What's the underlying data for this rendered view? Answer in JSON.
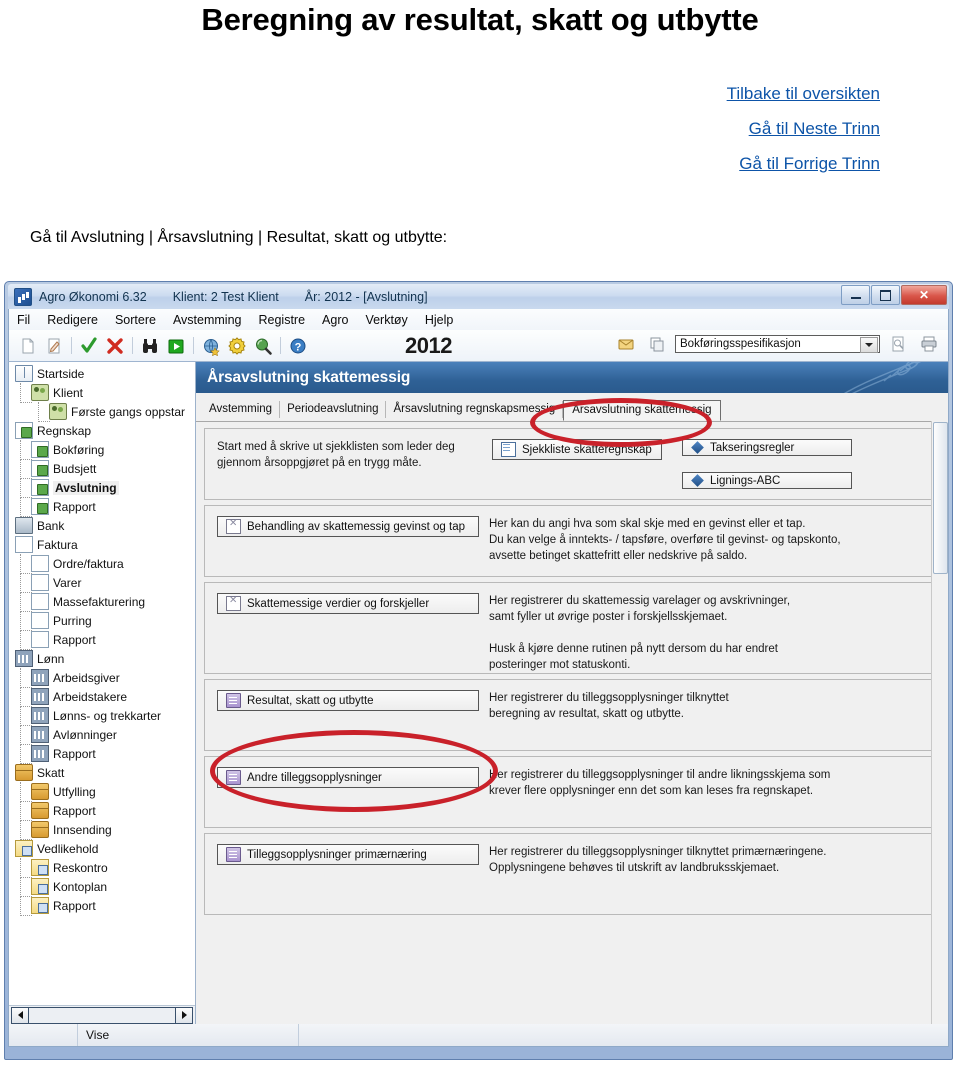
{
  "document": {
    "title": "Beregning av resultat, skatt og utbytte",
    "nav_links": [
      "Tilbake til oversikten",
      "Gå til Neste Trinn",
      "Gå til Forrige Trinn"
    ],
    "breadcrumb": "Gå til Avslutning | Årsavslutning | Resultat, skatt og utbytte:"
  },
  "app": {
    "titlebar": {
      "product": "Agro Økonomi 6.32",
      "client": "Klient:  2 Test Klient",
      "year": "År: 2012 - [Avslutning]",
      "minimize_label": "Minimer",
      "maximize_label": "Maksimer",
      "close_label": "✕"
    },
    "menu": [
      "Fil",
      "Redigere",
      "Sortere",
      "Avstemming",
      "Registre",
      "Agro",
      "Verktøy",
      "Hjelp"
    ],
    "toolbar": {
      "year_display": "2012",
      "combo_value": "Bokføringsspesifikasjon",
      "icons": [
        "new-document-icon",
        "edit-document-icon",
        "confirm-check-icon",
        "delete-cross-icon",
        "binoculars-search-icon",
        "run-play-icon",
        "globe-star-icon",
        "settings-gear-icon",
        "magnifier-icon",
        "help-question-icon"
      ],
      "right_icons": [
        "mail-icon",
        "copy-icon",
        "preview-icon",
        "print-icon"
      ]
    },
    "tree": [
      {
        "label": "Startside",
        "level": 1,
        "icon": "book-icon",
        "selected": false
      },
      {
        "label": "Klient",
        "level": 2,
        "icon": "people-icon",
        "selected": false
      },
      {
        "label": "Første gangs oppstar",
        "level": 3,
        "icon": "people-icon",
        "selected": false
      },
      {
        "label": "Regnskap",
        "level": 1,
        "icon": "check-doc-icon",
        "selected": false
      },
      {
        "label": "Bokføring",
        "level": 2,
        "icon": "check-doc-icon",
        "selected": false
      },
      {
        "label": "Budsjett",
        "level": 2,
        "icon": "check-doc-icon",
        "selected": false
      },
      {
        "label": "Avslutning",
        "level": 2,
        "icon": "check-doc-icon",
        "selected": true
      },
      {
        "label": "Rapport",
        "level": 2,
        "icon": "check-doc-icon",
        "selected": false
      },
      {
        "label": "Bank",
        "level": 1,
        "icon": "bank-icon",
        "selected": false
      },
      {
        "label": "Faktura",
        "level": 1,
        "icon": "doc-icon",
        "selected": false
      },
      {
        "label": "Ordre/faktura",
        "level": 2,
        "icon": "doc-icon",
        "selected": false
      },
      {
        "label": "Varer",
        "level": 2,
        "icon": "doc-icon",
        "selected": false
      },
      {
        "label": "Massefakturering",
        "level": 2,
        "icon": "doc-icon",
        "selected": false
      },
      {
        "label": "Purring",
        "level": 2,
        "icon": "doc-icon",
        "selected": false
      },
      {
        "label": "Rapport",
        "level": 2,
        "icon": "doc-icon",
        "selected": false
      },
      {
        "label": "Lønn",
        "level": 1,
        "icon": "grid-icon",
        "selected": false
      },
      {
        "label": "Arbeidsgiver",
        "level": 2,
        "icon": "grid-icon",
        "selected": false
      },
      {
        "label": "Arbeidstakere",
        "level": 2,
        "icon": "grid-icon",
        "selected": false
      },
      {
        "label": "Lønns- og trekkarter",
        "level": 2,
        "icon": "grid-icon",
        "selected": false
      },
      {
        "label": "Avlønninger",
        "level": 2,
        "icon": "grid-icon",
        "selected": false
      },
      {
        "label": "Rapport",
        "level": 2,
        "icon": "grid-icon",
        "selected": false
      },
      {
        "label": "Skatt",
        "level": 1,
        "icon": "box-icon",
        "selected": false
      },
      {
        "label": "Utfylling",
        "level": 2,
        "icon": "box-icon",
        "selected": false
      },
      {
        "label": "Rapport",
        "level": 2,
        "icon": "box-icon",
        "selected": false
      },
      {
        "label": "Innsending",
        "level": 2,
        "icon": "box-icon",
        "selected": false
      },
      {
        "label": "Vedlikehold",
        "level": 1,
        "icon": "yellow-doc-icon",
        "selected": false
      },
      {
        "label": "Reskontro",
        "level": 2,
        "icon": "yellow-doc-icon",
        "selected": false
      },
      {
        "label": "Kontoplan",
        "level": 2,
        "icon": "yellow-doc-icon",
        "selected": false
      },
      {
        "label": "Rapport",
        "level": 2,
        "icon": "yellow-doc-icon",
        "selected": false
      }
    ],
    "content": {
      "header_title": "Årsavslutning skattemessig",
      "tabs": [
        {
          "label": "Avstemming",
          "active": false
        },
        {
          "label": "Periodeavslutning",
          "active": false
        },
        {
          "label": "Årsavslutning regnskapsmessig",
          "active": false
        },
        {
          "label": "Årsavslutning skattemessig",
          "active": true
        }
      ],
      "panels": [
        {
          "layout": "text-left",
          "text": "Start med å skrive ut sjekklisten som leder deg\ngjennom årsoppgjøret på en trygg måte.",
          "buttons": [
            {
              "label": "Sjekkliste skatteregnskap",
              "icon": "list-icon",
              "width": 170
            },
            {
              "label": "Takseringsregler",
              "icon": "diamond-icon",
              "width": 170
            },
            {
              "label": "Lignings-ABC",
              "icon": "diamond-icon",
              "width": 170
            }
          ]
        },
        {
          "layout": "button-left",
          "button": {
            "label": "Behandling av skattemessig gevinst og tap",
            "icon": "excel-icon"
          },
          "text": "Her kan du angi hva som skal skje med en gevinst eller et tap.\nDu kan velge å inntekts- / tapsføre, overføre til gevinst- og tapskonto,\navsette betinget skattefritt eller nedskrive på saldo."
        },
        {
          "layout": "button-left",
          "button": {
            "label": "Skattemessige verdier og forskjeller",
            "icon": "excel-icon"
          },
          "text": "Her registrerer du skattemessig varelager og avskrivninger,\nsamt fyller ut øvrige poster i forskjellsskjemaet.\n\nHusk å kjøre denne rutinen på nytt dersom du har endret\nposteringer mot statuskonti."
        },
        {
          "layout": "button-left",
          "button": {
            "label": "Resultat, skatt og utbytte",
            "icon": "note-icon"
          },
          "text": "Her registrerer du tilleggsopplysninger tilknyttet\nberegning av resultat, skatt og utbytte."
        },
        {
          "layout": "button-left",
          "button": {
            "label": "Andre tilleggsopplysninger",
            "icon": "note-icon"
          },
          "text": "Her registrerer du tilleggsopplysninger til andre likningsskjema som\nkrever flere opplysninger enn det som kan leses fra regnskapet."
        },
        {
          "layout": "button-left",
          "button": {
            "label": "Tilleggsopplysninger primærnæring",
            "icon": "note-icon"
          },
          "text": "Her registrerer du tilleggsopplysninger tilknyttet primærnæringene.\nOpplysningene behøves til utskrift av landbruksskjemaet."
        }
      ]
    },
    "statusbar": {
      "cell_left": "",
      "cell_mid": "Vise",
      "cell_right": ""
    }
  },
  "annotations": {
    "color": "#c9212a",
    "items": [
      {
        "name": "highlight-ellipse-active-tab",
        "label": "Årsavslutning skattemessig"
      },
      {
        "name": "highlight-ellipse-resultat-button",
        "label": "Resultat, skatt og utbytte"
      }
    ]
  }
}
